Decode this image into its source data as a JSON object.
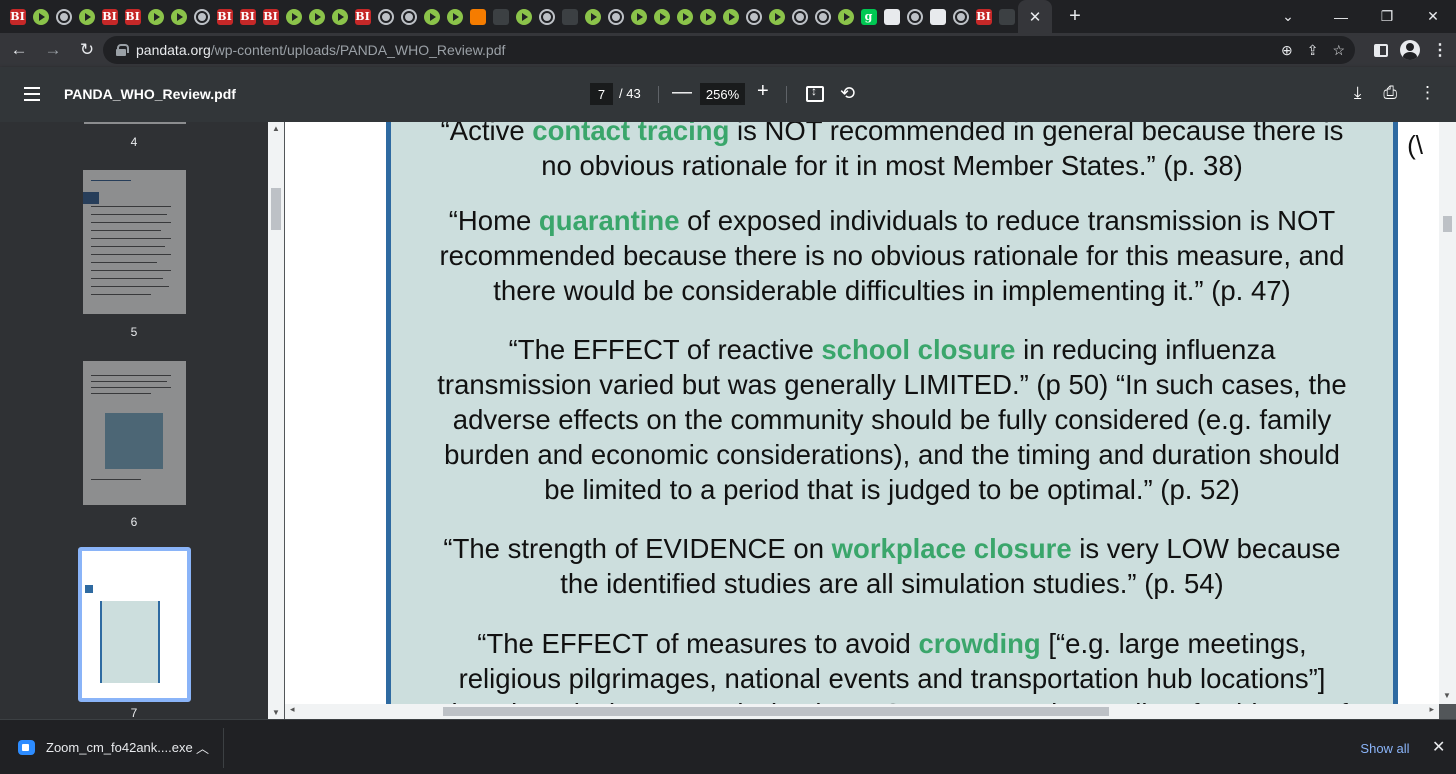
{
  "browser": {
    "tab_favicons": [
      "bi",
      "play",
      "globe",
      "play",
      "bi",
      "bi",
      "play",
      "play",
      "globe",
      "bi",
      "bi",
      "bi",
      "play",
      "play",
      "play",
      "bi",
      "globe",
      "globe",
      "play",
      "play",
      "sub",
      "dark",
      "play",
      "globe",
      "dark",
      "play",
      "globe",
      "play",
      "play",
      "play",
      "play",
      "play",
      "globe",
      "play",
      "globe",
      "globe",
      "play",
      "gg",
      "grid",
      "globe",
      "grid",
      "globe",
      "bi",
      "dark"
    ],
    "active_tab_close": "✕",
    "new_tab": "+",
    "url_host": "pandata.org",
    "url_path": "/wp-content/uploads/PANDA_WHO_Review.pdf"
  },
  "pdf": {
    "title": "PANDA_WHO_Review.pdf",
    "current_page": "7",
    "total_pages": "/ 43",
    "zoom": "256%"
  },
  "sidebar": {
    "thumbnails": [
      {
        "label": "4"
      },
      {
        "label": "5"
      },
      {
        "label": "6"
      },
      {
        "label": "7"
      }
    ]
  },
  "document": {
    "paragraphs": [
      {
        "lines": [
          [
            {
              "t": "“Active "
            },
            {
              "t": "contact tracing",
              "kw": true
            },
            {
              "t": " is NOT recommended in general because there is"
            }
          ],
          [
            {
              "t": "no obvious rationale for it in most Member States.” (p. 38)"
            }
          ]
        ]
      },
      {
        "lines": [
          [
            {
              "t": "“Home "
            },
            {
              "t": "quarantine",
              "kw": true
            },
            {
              "t": " of exposed individuals to reduce transmission is NOT"
            }
          ],
          [
            {
              "t": "recommended because there is no obvious rationale for this measure, and"
            }
          ],
          [
            {
              "t": "there would be considerable difficulties in implementing it.” (p. 47)"
            }
          ]
        ]
      },
      {
        "lines": [
          [
            {
              "t": "“The EFFECT of reactive "
            },
            {
              "t": "school closure",
              "kw": true
            },
            {
              "t": " in reducing influenza"
            }
          ],
          [
            {
              "t": "transmission varied but was generally LIMITED.” (p 50) “In such cases, the"
            }
          ],
          [
            {
              "t": "adverse effects on the community should be fully considered (e.g. family"
            }
          ],
          [
            {
              "t": "burden and economic considerations), and the timing and duration should"
            }
          ],
          [
            {
              "t": "be limited to a period that is judged to be optimal.” (p. 52)"
            }
          ]
        ]
      },
      {
        "lines": [
          [
            {
              "t": "“The strength of EVIDENCE on "
            },
            {
              "t": "workplace closure",
              "kw": true
            },
            {
              "t": " is very LOW because"
            }
          ],
          [
            {
              "t": "the identified studies are all simulation studies.” (p. 54)"
            }
          ]
        ]
      },
      {
        "lines": [
          [
            {
              "t": "“The EFFECT of measures to avoid "
            },
            {
              "t": "crowding",
              "kw": true
            },
            {
              "t": "  [“e.g. large meetings,"
            }
          ],
          [
            {
              "t": "religious pilgrimages, national events and transportation hub locations”]"
            }
          ],
          [
            {
              "t": "alone in reducing transmission is UNCERTAIN … the quality of evidence of"
            }
          ]
        ]
      }
    ],
    "margin_fragment": "(\\"
  },
  "downloads": {
    "filename": "Zoom_cm_fo42ank....exe",
    "show_all": "Show all"
  },
  "colors": {
    "keyword": "#3aa66b",
    "quote_bg": "#ccdedd",
    "quote_border": "#2e6aa1",
    "link": "#8ab4f8"
  }
}
